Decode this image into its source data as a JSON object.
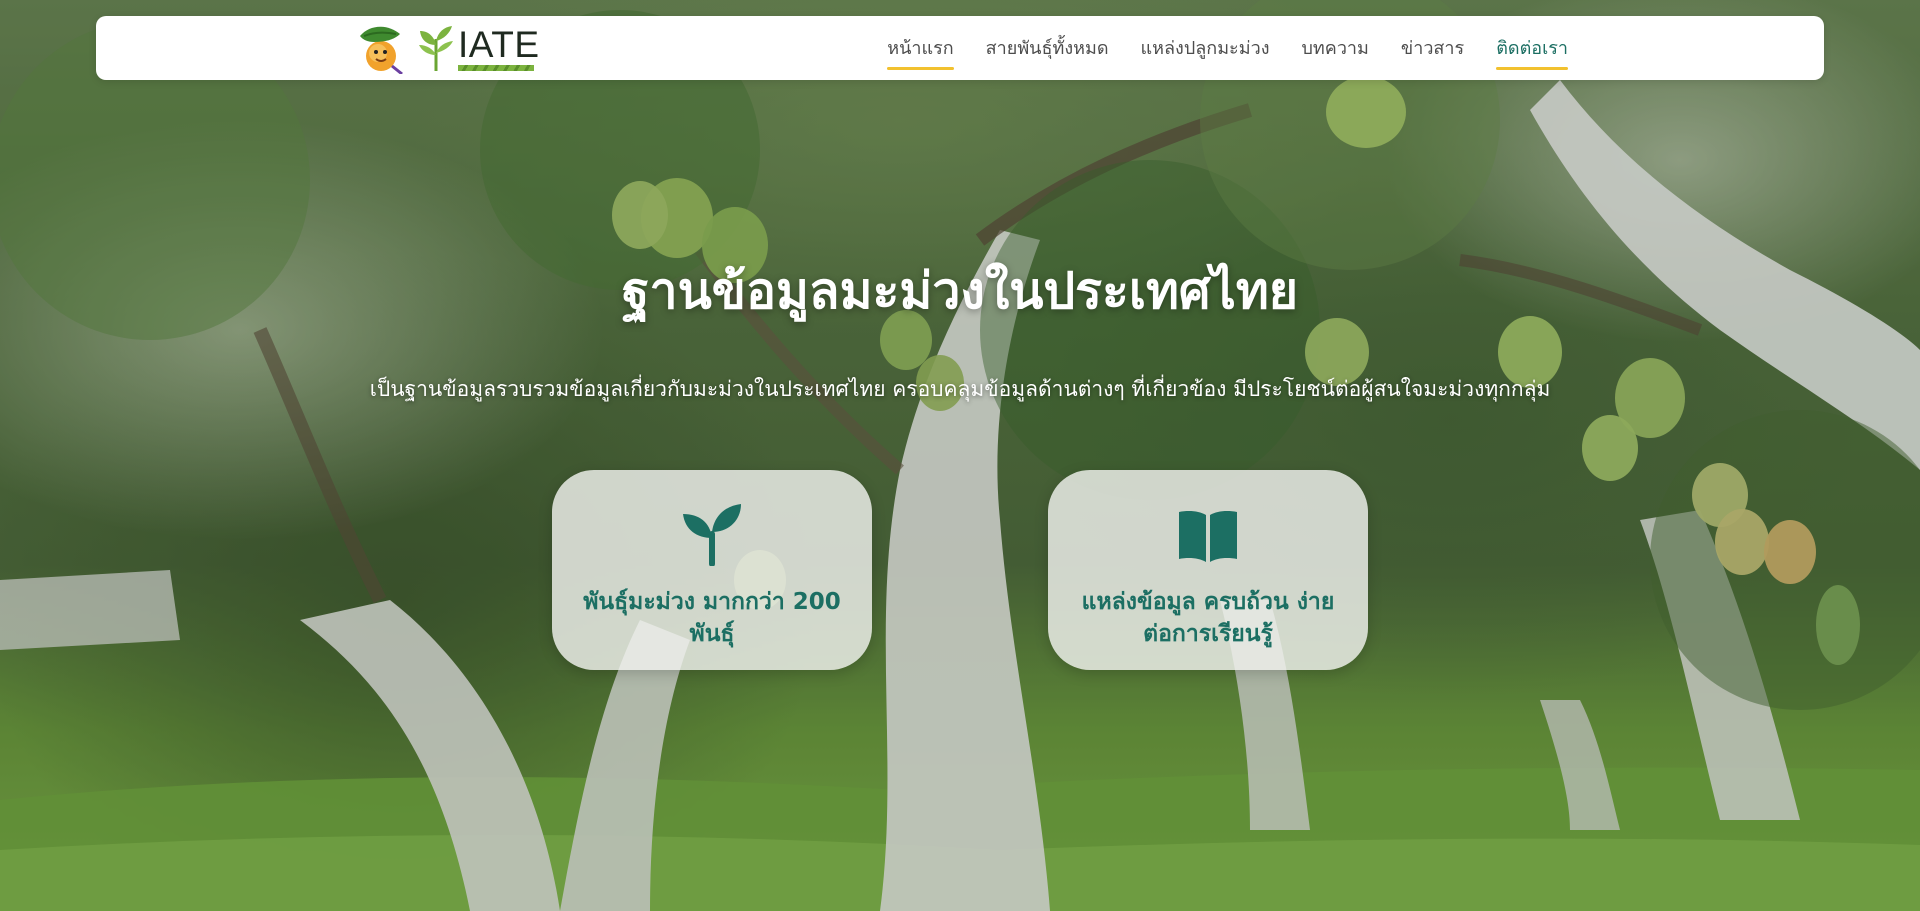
{
  "header": {
    "logo_text": "IATE",
    "nav_items": [
      {
        "label": "หน้าแรก"
      },
      {
        "label": "สายพันธุ์ทั้งหมด"
      },
      {
        "label": "แหล่งปลูกมะม่วง"
      },
      {
        "label": "บทความ"
      },
      {
        "label": "ข่าวสาร"
      },
      {
        "label": "ติดต่อเรา"
      }
    ]
  },
  "hero": {
    "title": "ฐานข้อมูลมะม่วงในประเทศไทย",
    "subtitle": "เป็นฐานข้อมูลรวบรวมข้อมูลเกี่ยวกับมะม่วงในประเทศไทย ครอบคลุมข้อมูลด้านต่างๆ ที่เกี่ยวข้อง มีประโยชน์ต่อผู้สนใจมะม่วงทุกกลุ่ม"
  },
  "features": [
    {
      "icon": "seedling-icon",
      "text": "พันธุ์มะม่วง มากกว่า 200 พันธุ์"
    },
    {
      "icon": "book-icon",
      "text": "แหล่งข้อมูล ครบถ้วน ง่ายต่อการเรียนรู้"
    }
  ],
  "colors": {
    "accent": "#1c6f63",
    "underline": "#f2c12e",
    "nav_text": "#4d4d4d"
  }
}
